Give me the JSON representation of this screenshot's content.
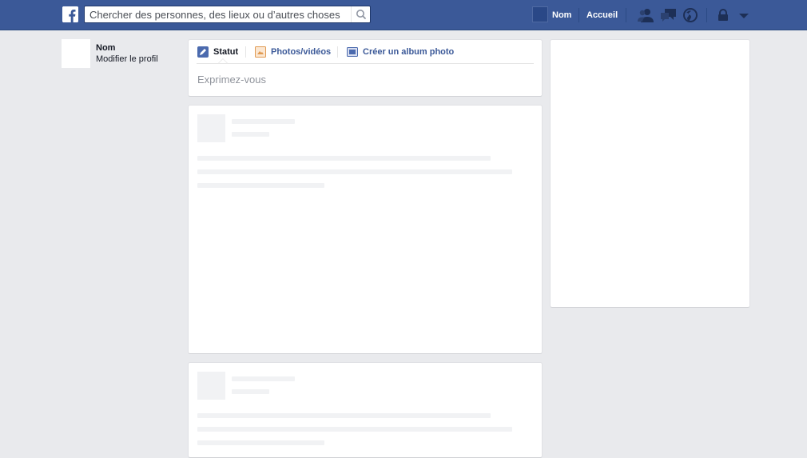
{
  "topbar": {
    "logo_icon": "facebook-logo-icon",
    "search_placeholder": "Chercher des personnes, des lieux ou d’autres choses",
    "search_icon": "magnifier-icon",
    "profile_label": "Nom",
    "home_label": "Accueil",
    "jewels": [
      "friend-requests-icon",
      "messages-icon",
      "notifications-globe-icon"
    ],
    "privacy_icon": "privacy-lock-icon",
    "menu_icon": "dropdown-arrow-icon"
  },
  "left": {
    "name": "Nom",
    "edit_profile": "Modifier le profil"
  },
  "composer": {
    "tabs": [
      {
        "label": "Statut",
        "icon": "pencil-icon",
        "active": true
      },
      {
        "label": "Photos/vidéos",
        "icon": "photo-icon",
        "active": false
      },
      {
        "label": "Créer un album photo",
        "icon": "album-icon",
        "active": false
      }
    ],
    "placeholder": "Exprimez-vous"
  },
  "colors": {
    "brand": "#3b5998",
    "background": "#e9eaed",
    "placeholder_grey": "#f1f2f4"
  }
}
